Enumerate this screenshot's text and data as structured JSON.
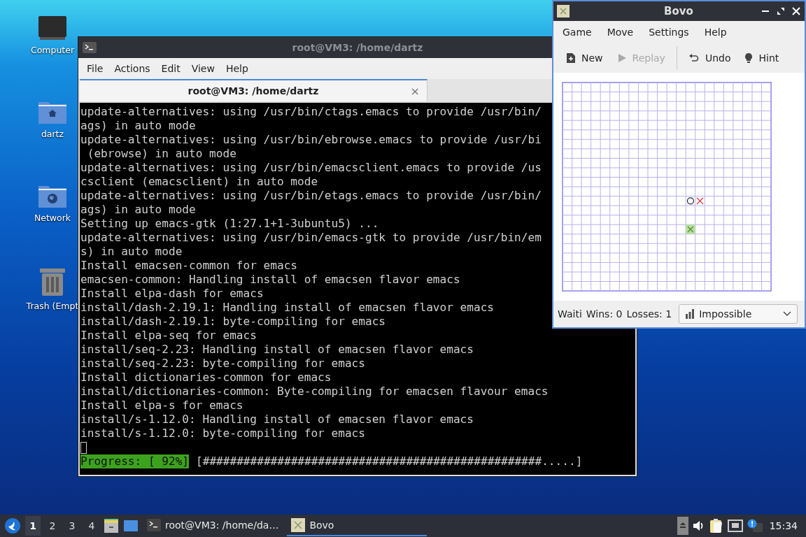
{
  "desktop_icons": [
    {
      "label": "Computer",
      "kind": "computer"
    },
    {
      "label": "dartz",
      "kind": "home"
    },
    {
      "label": "Network",
      "kind": "network"
    },
    {
      "label": "Trash (Empt",
      "kind": "trash"
    }
  ],
  "terminal": {
    "title": "root@VM3: /home/dartz",
    "menu": [
      "File",
      "Actions",
      "Edit",
      "View",
      "Help"
    ],
    "tab": {
      "label": "root@VM3: /home/dartz",
      "close": "×"
    },
    "lines": [
      "update-alternatives: using /usr/bin/ctags.emacs to provide /usr/bin/",
      "ags) in auto mode",
      "update-alternatives: using /usr/bin/ebrowse.emacs to provide /usr/bi",
      " (ebrowse) in auto mode",
      "update-alternatives: using /usr/bin/emacsclient.emacs to provide /us",
      "csclient (emacsclient) in auto mode",
      "update-alternatives: using /usr/bin/etags.emacs to provide /usr/bin/",
      "ags) in auto mode",
      "Setting up emacs-gtk (1:27.1+1-3ubuntu5) ...",
      "update-alternatives: using /usr/bin/emacs-gtk to provide /usr/bin/em",
      "s) in auto mode",
      "Install emacsen-common for emacs",
      "emacsen-common: Handling install of emacsen flavor emacs",
      "Install elpa-dash for emacs",
      "install/dash-2.19.1: Handling install of emacsen flavor emacs",
      "install/dash-2.19.1: byte-compiling for emacs",
      "Install elpa-seq for emacs",
      "install/seq-2.23: Handling install of emacsen flavor emacs",
      "install/seq-2.23: byte-compiling for emacs",
      "Install dictionaries-common for emacs",
      "install/dictionaries-common: Byte-compiling for emacsen flavour emacs",
      "Install elpa-s for emacs",
      "install/s-1.12.0: Handling install of emacsen flavor emacs",
      "install/s-1.12.0: byte-compiling for emacs"
    ],
    "progress_label": "Progress: [ 92%]",
    "progress_bar": "[##################################################.....]"
  },
  "bovo": {
    "title": "Bovo",
    "menu": [
      "Game",
      "Move",
      "Settings",
      "Help"
    ],
    "toolbar": [
      {
        "label": "New",
        "kind": "new",
        "disabled": false
      },
      {
        "label": "Replay",
        "kind": "replay",
        "disabled": true
      },
      {
        "label": "Undo",
        "kind": "undo",
        "disabled": false
      },
      {
        "label": "Hint",
        "kind": "hint",
        "disabled": false
      }
    ],
    "pieces": [
      {
        "kind": "o"
      },
      {
        "kind": "x"
      },
      {
        "kind": "hint"
      }
    ],
    "status": [
      "Waiti",
      "Wins: 0",
      "Losses: 1"
    ],
    "difficulty": "Impossible"
  },
  "taskbar": {
    "workspaces": [
      {
        "label": "1",
        "selected": true
      },
      {
        "label": "2",
        "selected": false
      },
      {
        "label": "3",
        "selected": false
      },
      {
        "label": "4",
        "selected": false
      }
    ],
    "tasks": [
      {
        "label": "root@VM3: /home/da…",
        "kind": "terminal",
        "selected": false
      },
      {
        "label": "Bovo",
        "kind": "bovo",
        "selected": true
      }
    ],
    "clock": "15:34"
  }
}
